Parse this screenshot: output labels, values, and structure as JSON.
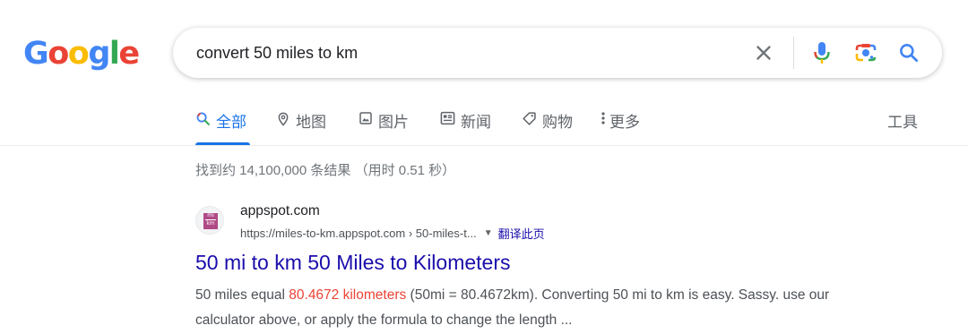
{
  "logo": {
    "letters": [
      "G",
      "o",
      "o",
      "g",
      "l",
      "e"
    ]
  },
  "search": {
    "query": "convert 50 miles to km"
  },
  "tabs": [
    {
      "label": "全部",
      "icon": "search-icon"
    },
    {
      "label": "地图",
      "icon": "map-pin-icon"
    },
    {
      "label": "图片",
      "icon": "image-icon"
    },
    {
      "label": "新闻",
      "icon": "news-icon"
    },
    {
      "label": "购物",
      "icon": "tag-icon"
    },
    {
      "label": "更多",
      "icon": "more-vert-icon"
    }
  ],
  "tools_label": "工具",
  "stats": "找到约 14,100,000 条结果 （用时 0.51 秒）",
  "result": {
    "favicon_text": [
      "mi",
      "km"
    ],
    "site_name": "appspot.com",
    "url": "https://miles-to-km.appspot.com › 50-miles-t...",
    "translate": "翻译此页",
    "title": "50 mi to km 50 Miles to Kilometers",
    "snippet_pre": "50 miles equal ",
    "snippet_highlight": "80.4672 kilometers",
    "snippet_post": " (50mi = 80.4672km). Converting 50 mi to km is easy. Sassy. use our calculator above, or apply the formula to change the length ..."
  },
  "colors": {
    "accent": "#1a73e8",
    "link": "#1a0dab",
    "highlight": "#ea4335"
  }
}
